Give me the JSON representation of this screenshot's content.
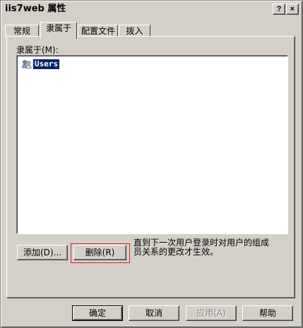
{
  "window": {
    "title": "iis7web 属性",
    "help_button": "?",
    "close_button": "×"
  },
  "tabs": [
    {
      "label": "常规",
      "active": false
    },
    {
      "label": "隶属于",
      "active": true
    },
    {
      "label": "配置文件",
      "active": false
    },
    {
      "label": "拨入",
      "active": false
    }
  ],
  "member_of": {
    "label": "隶属于(M):",
    "items": [
      {
        "name": "Users",
        "icon": "group-icon",
        "selected": true
      }
    ]
  },
  "actions": {
    "add_label": "添加(D)...",
    "remove_label": "删除(R)",
    "hint": "直到下一次用户登录时对用户的组成员关系的更改才生效。"
  },
  "footer": {
    "ok_label": "确定",
    "cancel_label": "取消",
    "apply_label": "应用(A)",
    "apply_disabled": true,
    "help_label": "帮助"
  },
  "colors": {
    "face": "#d4d0c8",
    "selection": "#0a246a",
    "highlight": "#e02020"
  }
}
